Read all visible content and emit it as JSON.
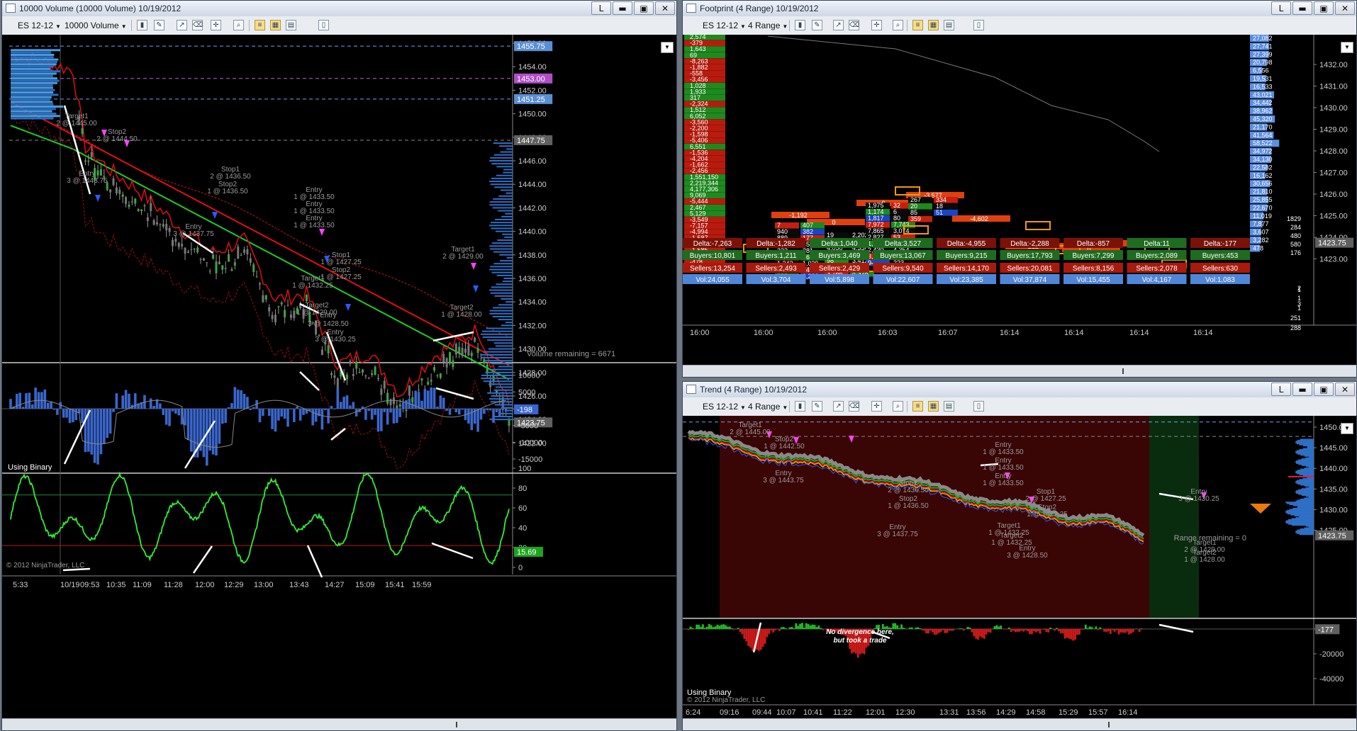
{
  "windows": {
    "volume": {
      "title": "10000 Volume (10000 Volume)  10/19/2012",
      "instrument": "ES 12-12",
      "period": "10000 Volume"
    },
    "footprint": {
      "title": "Footprint (4 Range)  10/19/2012",
      "instrument": "ES 12-12",
      "period": "4 Range"
    },
    "trend": {
      "title": "Trend (4 Range)  10/19/2012",
      "instrument": "ES 12-12",
      "period": "4 Range"
    }
  },
  "window_buttons": {
    "link": "L",
    "minimize": "▬",
    "maximize": "▣",
    "close": "✕"
  },
  "volume_chart": {
    "price_axis": [
      "1456.00",
      "1454.00",
      "1452.00",
      "1450.00",
      "1448.00",
      "1446.00",
      "1444.00",
      "1442.00",
      "1440.00",
      "1438.00",
      "1436.00",
      "1434.00",
      "1432.00",
      "1430.00",
      "1428.00",
      "1426.00",
      "1424.00",
      "1422.00"
    ],
    "price_flags": [
      {
        "text": "1455.75",
        "color": "#5b8fd4"
      },
      {
        "text": "1453.00",
        "color": "#b04fc8"
      },
      {
        "text": "1451.25",
        "color": "#5b8fd4"
      },
      {
        "text": "1447.75",
        "color": "#606060"
      },
      {
        "text": "1423.75",
        "color": "#606060"
      }
    ],
    "annotations": [
      "Target1",
      "2 @ 1445.00",
      "Stop2",
      "2 @ 1444.50",
      "Entry",
      "3 @ 1443.75",
      "Stop1",
      "2 @ 1436.50",
      "Stop2",
      "1 @ 1436.50",
      "Entry",
      "3 @ 1437.75",
      "Entry",
      "1 @ 1433.50",
      "Entry",
      "1 @ 1433.50",
      "Entry",
      "1 @ 1433.50",
      "Stop1",
      "1 @ 1427.25",
      "Stop2",
      "1 @ 1427.25",
      "Target1",
      "1 @ 1432.25",
      "Target2",
      "1 @ 1429.00",
      "Entry",
      "3 @ 1428.50",
      "Entry",
      "3 @ 1430.25",
      "Target1",
      "2 @ 1429.00",
      "Target2",
      "1 @ 1428.00"
    ],
    "volume_remaining": "Volume remaining = 6671",
    "delta_axis": [
      "10000",
      "5000",
      "0",
      "-5000",
      "-10000",
      "-15000",
      "-20000"
    ],
    "delta_flag": "-198",
    "delta_label": "Using Binary",
    "osc_axis": [
      "100",
      "80",
      "60",
      "40",
      "20",
      "0"
    ],
    "osc_flag": "15.69",
    "copyright": "© 2012 NinjaTrader, LLC",
    "time_axis": [
      "5:33",
      "10/19",
      "09:53",
      "10:35",
      "11:09",
      "11:28",
      "12:00",
      "12:29",
      "13:00",
      "13:43",
      "14:27",
      "15:09",
      "15:41",
      "15:59"
    ]
  },
  "footprint_chart": {
    "price_axis": [
      "1432.00",
      "1431.00",
      "1430.00",
      "1429.00",
      "1428.00",
      "1427.00",
      "1426.00",
      "1425.00",
      "1424.00",
      "1423.00"
    ],
    "price_flag": "1423.75",
    "left_deltas": [
      "2,574",
      "-379",
      "1,643",
      "69",
      "-8,263",
      "-1,882",
      "-558",
      "-3,456",
      "1,028",
      "1,933",
      "317",
      "-2,324",
      "1,512",
      "6,052",
      "-3,560",
      "-2,200",
      "-1,598",
      "-5,406",
      "6,551",
      "-1,536",
      "-4,204",
      "-1,662",
      "-2,456",
      "1,551,150",
      "2,219,344",
      "4,177,306",
      "9,069",
      "-5,444",
      "2,467",
      "5,129",
      "-3,549",
      "-7,157",
      "-4,994",
      "-1,587",
      "2,297",
      "-1,585",
      "-1,410",
      "-478"
    ],
    "bar_deltas": [
      "-1,192",
      "0",
      "0",
      "-3,577",
      "-4,602",
      "-212",
      "0",
      "-7"
    ],
    "rows": {
      "delta": [
        "Delta:-7,263",
        "Delta:-1,282",
        "Delta:1,040",
        "Delta:3,527",
        "Delta:-4,955",
        "Delta:-2,288",
        "Delta:-857",
        "Delta:11",
        "Delta:-177"
      ],
      "buyers": [
        "Buyers:10,801",
        "Buyers:1,211",
        "Buyers:3,469",
        "Buyers:13,067",
        "Buyers:9,215",
        "Buyers:17,793",
        "Buyers:7,299",
        "Buyers:2,089",
        "Buyers:453"
      ],
      "sellers": [
        "Sellers:13,254",
        "Sellers:2,493",
        "Sellers:2,429",
        "Sellers:9,540",
        "Sellers:14,170",
        "Sellers:20,081",
        "Sellers:8,156",
        "Sellers:2,078",
        "Sellers:630"
      ],
      "vol": [
        "Vol:24,055",
        "Vol:3,704",
        "Vol:5,898",
        "Vol:22,607",
        "Vol:23,385",
        "Vol:37,874",
        "Vol:15,455",
        "Vol:4,167",
        "Vol:1,083"
      ]
    },
    "cells": [
      "7",
      "407",
      "940",
      "382",
      "889",
      "177",
      "435",
      "45",
      "222",
      "281",
      "515",
      "563",
      "1,243",
      "1,039",
      "948",
      "546",
      "663",
      "1,236",
      "19",
      "2,202",
      "3,053",
      "4,396",
      "4,050",
      "4,356",
      "2,320",
      "1,513",
      "98",
      "3,412",
      "2,235",
      "825",
      "3,766",
      "4,328",
      "8,786",
      "4,024",
      "1,975",
      "32",
      "1,174",
      "6",
      "1,817",
      "80",
      "7,972",
      "7,743",
      "7,865",
      "3,074",
      "2,827",
      "53",
      "1,167",
      "337",
      "2,430",
      "4,354",
      "3,272",
      "636",
      "9",
      "223",
      "267",
      "334",
      "20",
      "18",
      "85",
      "51",
      "359"
    ],
    "right_volumes": [
      "27,082",
      "27,741",
      "27,399",
      "20,798",
      "6,556",
      "19,531",
      "16,533",
      "43,021",
      "34,442",
      "38,962",
      "45,320",
      "21,170",
      "41,564",
      "58,522",
      "34,972",
      "34,130",
      "22,582",
      "16,162",
      "30,656",
      "21,810",
      "25,855",
      "22,670",
      "11,019",
      "7,877",
      "3,607",
      "3,282",
      "478"
    ],
    "right_counts": [
      "1829",
      "284",
      "480",
      "580",
      "176",
      "1",
      "3",
      "2",
      "1",
      "1",
      "251",
      "288"
    ],
    "time_axis": [
      "16:00",
      "16:00",
      "16:00",
      "16:03",
      "16:07",
      "16:14",
      "16:14",
      "16:14",
      "16:14"
    ]
  },
  "trend_chart": {
    "price_axis": [
      "1450.00",
      "1445.00",
      "1440.00",
      "1435.00",
      "1430.00",
      "1425.00"
    ],
    "price_flag": "1423.75",
    "annotations": [
      "Target1",
      "2 @ 1445.00",
      "Stop2",
      "1 @ 1442.50",
      "Entry",
      "3 @ 1443.75",
      "Stop1",
      "2 @ 1436.50",
      "Stop2",
      "1 @ 1436.50",
      "Entry",
      "3 @ 1437.75",
      "Entry",
      "1 @ 1433.50",
      "Entry",
      "1 @ 1433.50",
      "Entry",
      "1 @ 1433.50",
      "Stop1",
      "2 @ 1427.25",
      "Stop2",
      "1 @ 1427.25",
      "Target1",
      "1 @ 1432.25",
      "Target2",
      "1 @ 1432.25",
      "Entry",
      "3 @ 1428.50",
      "Entry",
      "3 @ 1430.25",
      "Target1",
      "2 @ 1429.00",
      "Target2",
      "1 @ 1428.00"
    ],
    "range_remaining": "Range remaining = 0",
    "note_line1": "No divergence here,",
    "note_line2": "but took a trade",
    "delta_label": "Using Binary",
    "delta_axis": [
      "0",
      "-20000",
      "-40000"
    ],
    "delta_flag": "-177",
    "copyright": "© 2012 NinjaTrader, LLC",
    "time_axis": [
      "6:24",
      "09:16",
      "09:44",
      "10:07",
      "10:41",
      "11:22",
      "12:01",
      "12:30",
      "13:31",
      "13:56",
      "14:29",
      "14:58",
      "15:29",
      "15:57",
      "16:14"
    ]
  }
}
